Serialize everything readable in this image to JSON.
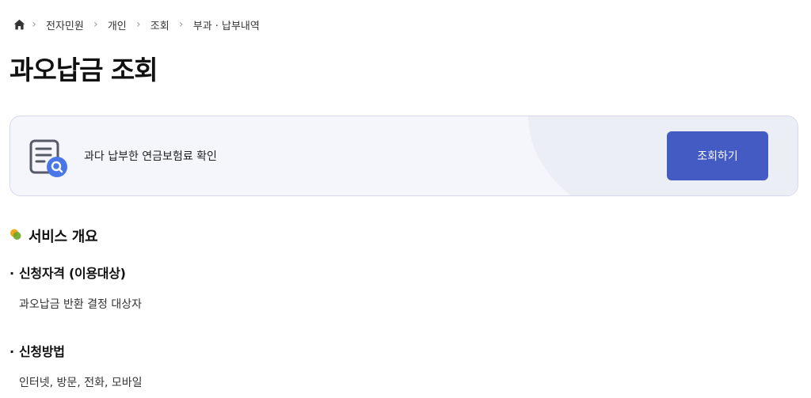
{
  "breadcrumb": {
    "items": [
      "전자민원",
      "개인",
      "조회",
      "부과 · 납부내역"
    ]
  },
  "page": {
    "title": "과오납금 조회"
  },
  "hero": {
    "description": "과다 납부한 연금보험료 확인",
    "button_label": "조회하기",
    "accent_color": "#435bc3",
    "icon": "document-search-icon"
  },
  "overview": {
    "title": "서비스 개요",
    "icon": "section-bullet-icon",
    "items": [
      {
        "heading": "신청자격 (이용대상)",
        "body": "과오납금 반환 결정 대상자"
      },
      {
        "heading": "신청방법",
        "body": "인터넷, 방문, 전화, 모바일"
      }
    ]
  }
}
